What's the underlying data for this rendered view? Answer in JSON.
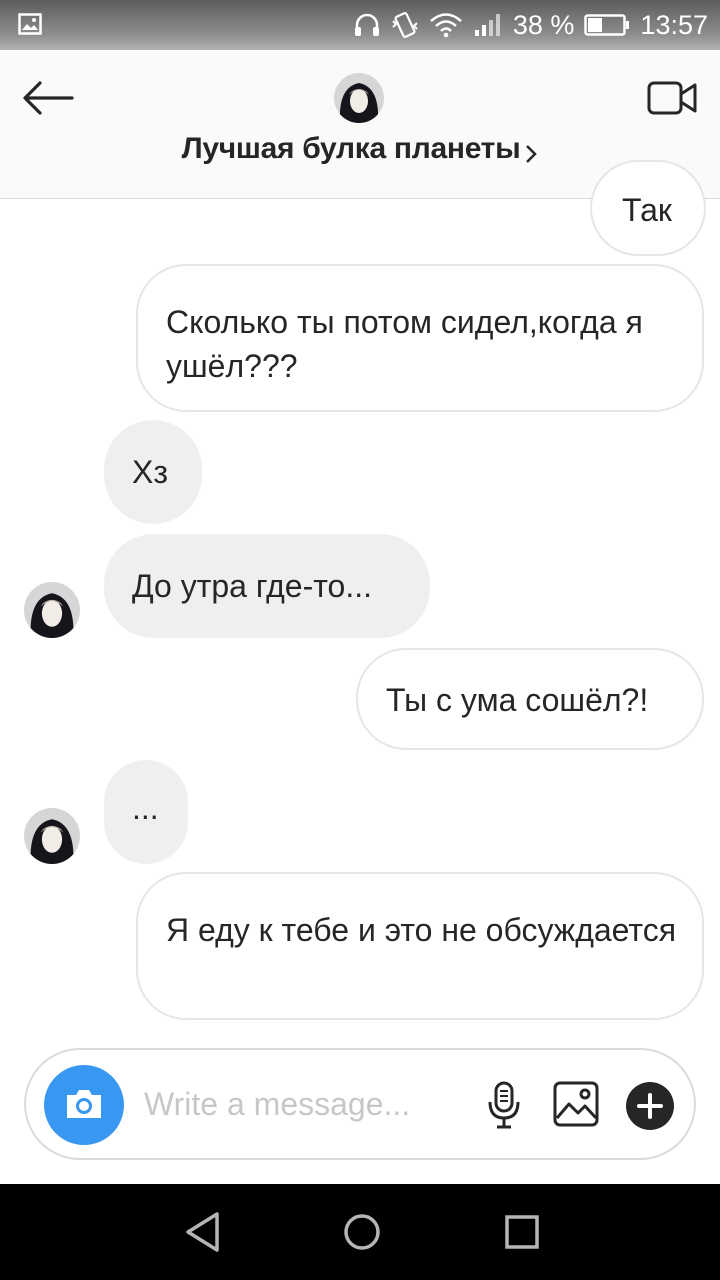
{
  "status_bar": {
    "battery": "38 %",
    "time": "13:57"
  },
  "header": {
    "title": "Лучшая булка планеты"
  },
  "messages": [
    {
      "side": "out",
      "text": "Так"
    },
    {
      "side": "out",
      "text": "Сколько ты потом сидел,когда я ушёл???"
    },
    {
      "side": "in",
      "text": "Хз"
    },
    {
      "side": "in",
      "text": "До утра где-то..."
    },
    {
      "side": "out",
      "text": "Ты с ума сошёл?!"
    },
    {
      "side": "in",
      "text": "..."
    },
    {
      "side": "out",
      "text": "Я еду к тебе и это не обсуждается"
    }
  ],
  "composer": {
    "placeholder": "Write a message..."
  },
  "icons": {
    "status": [
      "gallery-icon",
      "headphones-icon",
      "vibrate-icon",
      "wifi-icon",
      "signal-icon",
      "battery-icon"
    ],
    "header": [
      "back-arrow-icon",
      "video-call-icon",
      "chevron-right-icon"
    ],
    "composer": [
      "camera-icon",
      "microphone-icon",
      "image-icon",
      "plus-icon"
    ],
    "navigation": [
      "nav-back-icon",
      "nav-home-icon",
      "nav-recents-icon"
    ]
  },
  "colors": {
    "accent": "#3897f0",
    "incoming_bubble": "#efefef",
    "outgoing_border": "#e6e6e6",
    "header_bg": "#fafafa"
  }
}
